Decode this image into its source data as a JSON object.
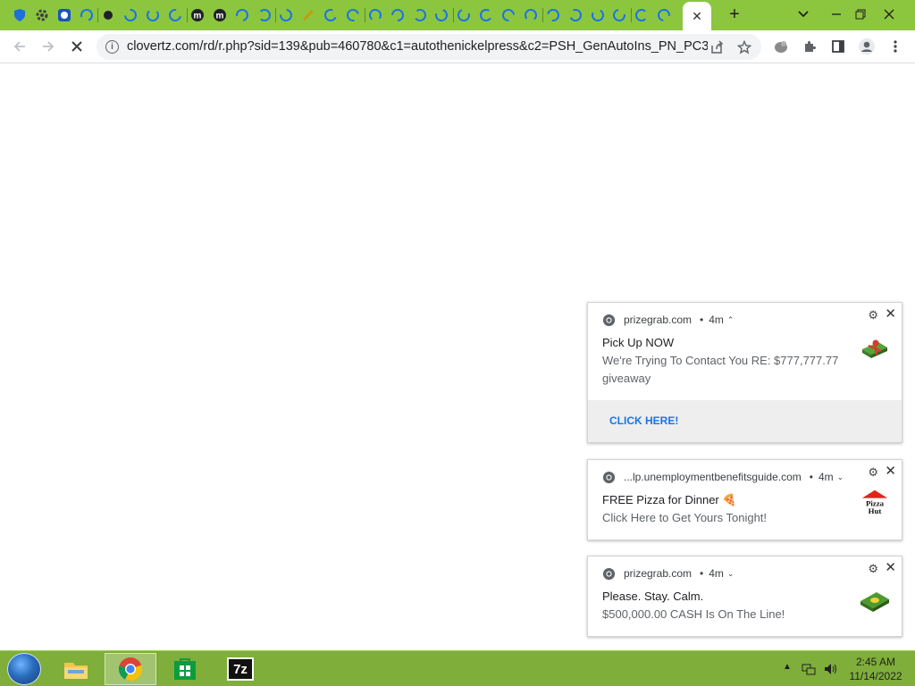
{
  "browser": {
    "url": "clovertz.com/rd/r.php?sid=139&pub=460780&c1=autothenickelpress&c2=PSH_GenAutoIns_PN_PC3_...",
    "tabs_icon_count": 30
  },
  "notifications": [
    {
      "origin": "prizegrab.com",
      "age": "4m",
      "title": "Pick Up NOW",
      "body": "We're Trying To Contact You RE: $777,777.77 giveaway",
      "action": "CLICK HERE!",
      "image": "gift-box-icon"
    },
    {
      "origin": "...lp.unemploymentbenefitsguide.com",
      "age": "4m",
      "title": "FREE Pizza for Dinner 🍕",
      "body": "Click Here to Get Yours Tonight!",
      "image": "pizza-hut-logo",
      "logo_text": "Pizza Hut"
    },
    {
      "origin": "prizegrab.com",
      "age": "4m",
      "title": "Please. Stay. Calm.",
      "body": "$500,000.00 CASH Is On The Line!",
      "image": "cash-stack-icon"
    }
  ],
  "taskbar": {
    "time": "2:45 AM",
    "date": "11/14/2022",
    "apps": [
      "file-explorer",
      "chrome",
      "store",
      "7zip"
    ],
    "sevenzip_label": "7z"
  },
  "colors": {
    "tabstrip": "#8cc63e",
    "taskbar": "#7fae3a",
    "link": "#1a73e8"
  }
}
